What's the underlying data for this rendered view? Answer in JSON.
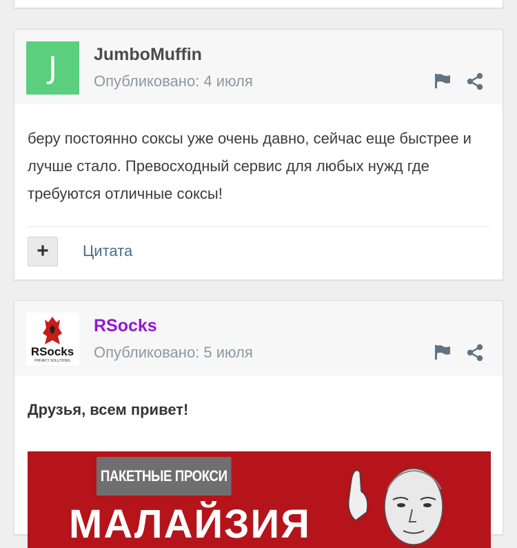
{
  "posts": [
    {
      "avatar_letter": "J",
      "author": "JumboMuffin",
      "posted": "Опубликовано: 4 июля",
      "body": "беру постоянно соксы уже очень давно, сейчас еще быстрее и лучше стало. Превосходный сервис для любых нужд где требуются отличные соксы!",
      "plus_label": "+",
      "quote_label": "Цитата"
    },
    {
      "avatar_logo_text": "RSocks",
      "avatar_logo_sub": "PRIVACY SOLUTIONS",
      "author": "RSocks",
      "posted": "Опубликовано: 5 июля",
      "body": "Друзья, всем привет!",
      "banner_label": "ПАКЕТНЫЕ ПРОКСИ",
      "banner_title": "МАЛАЙЗИЯ"
    }
  ],
  "icons": {
    "flag": "flag-icon",
    "share": "share-icon"
  },
  "colors": {
    "avatar_green": "#5bcf7d",
    "brand_purple": "#9316d6",
    "banner_red": "#b4141a"
  }
}
